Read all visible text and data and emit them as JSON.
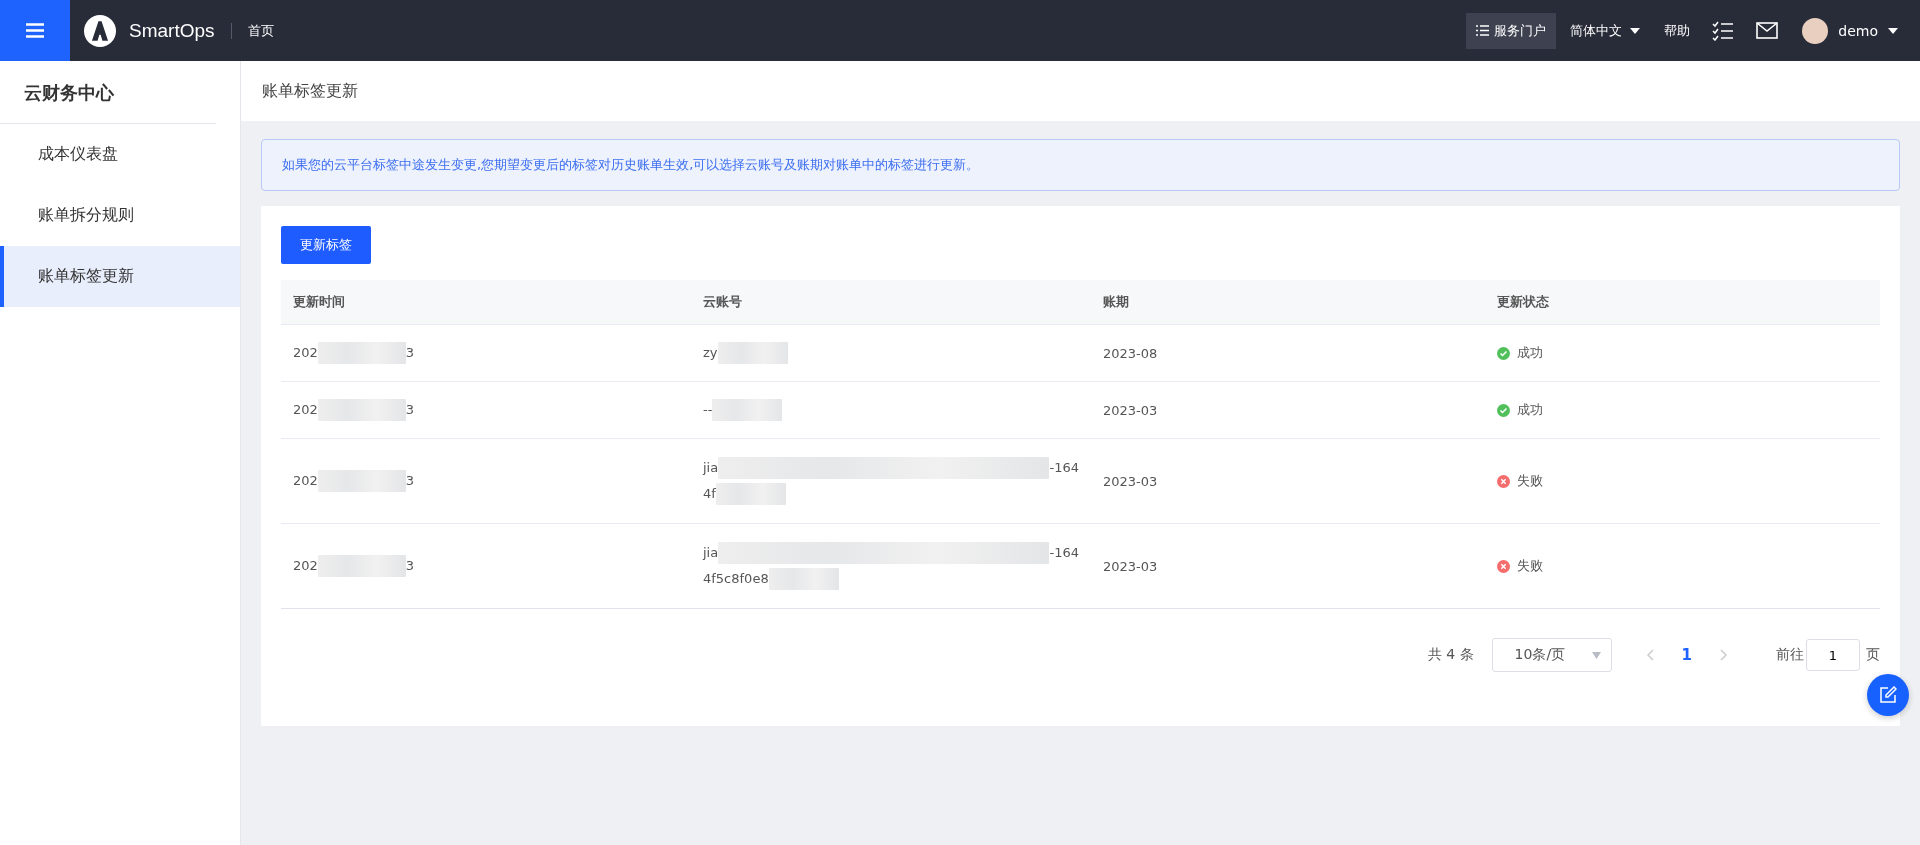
{
  "topbar": {
    "brand": "SmartOps",
    "breadcrumb": "首页",
    "portal": "服务门户",
    "language": "简体中文",
    "help": "帮助",
    "user": "demo"
  },
  "sidebar": {
    "title": "云财务中心",
    "items": [
      {
        "label": "成本仪表盘",
        "selected": false
      },
      {
        "label": "账单拆分规则",
        "selected": false
      },
      {
        "label": "账单标签更新",
        "selected": true
      }
    ]
  },
  "page_title": "账单标签更新",
  "alert": "如果您的云平台标签中途发生变更,您期望变更后的标签对历史账单生效,可以选择云账号及账期对账单中的标签进行更新。",
  "update_button": "更新标签",
  "table": {
    "columns": [
      "更新时间",
      "云账号",
      "账期",
      "更新状态"
    ],
    "rows": [
      {
        "time": {
          "start": "202",
          "end": "3"
        },
        "account": [
          {
            "start": "zy"
          }
        ],
        "period": "2023-08",
        "status": {
          "kind": "success",
          "label": "成功"
        }
      },
      {
        "time": {
          "start": "202",
          "end": "3"
        },
        "account": [
          {
            "start": "--"
          }
        ],
        "period": "2023-03",
        "status": {
          "kind": "success",
          "label": "成功"
        }
      },
      {
        "time": {
          "start": "202",
          "end": "3"
        },
        "account": [
          {
            "start": "jia",
            "end": "-164"
          },
          {
            "start": "4f"
          }
        ],
        "period": "2023-03",
        "status": {
          "kind": "fail",
          "label": "失败"
        }
      },
      {
        "time": {
          "start": "202",
          "end": "3"
        },
        "account": [
          {
            "start": "jia",
            "end": "-164"
          },
          {
            "start": "4f5c8f0e8"
          }
        ],
        "period": "2023-03",
        "status": {
          "kind": "fail",
          "label": "失败"
        }
      }
    ]
  },
  "pagination": {
    "total": "共 4 条",
    "page_size": "10条/页",
    "pages": [
      {
        "label": "1",
        "selected": true
      }
    ],
    "goto_label": "前往",
    "goto_value": "1",
    "goto_suffix": "页"
  }
}
